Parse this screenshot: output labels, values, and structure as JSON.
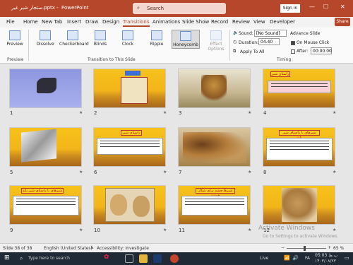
{
  "titlebar": {
    "filename": "ستجار شیر غیر.pptx",
    "separator": "-",
    "app": "PowerPoint",
    "search_placeholder": "Search",
    "signin": "Sign in",
    "minimize": "—",
    "maximize": "☐",
    "close": "✕"
  },
  "tabs": [
    "File",
    "Home",
    "New Tab",
    "Insert",
    "Draw",
    "Design",
    "Transitions",
    "Animations",
    "Slide Show",
    "Record",
    "Review",
    "View",
    "Developer"
  ],
  "active_tab": "Transitions",
  "share_label": "Share",
  "ribbon": {
    "preview": "Preview",
    "preview_group": "Preview",
    "transitions": [
      "Dissolve",
      "Checkerboard",
      "Blinds",
      "Clock",
      "Ripple",
      "Honeycomb"
    ],
    "selected_transition": "Honeycomb",
    "effect_options_1": "Effect",
    "effect_options_2": "Options",
    "transition_group": "Transition to This Slide",
    "sound_label": "Sound:",
    "sound_value": "[No Sound]",
    "duration_label": "Duration:",
    "duration_value": "04.40",
    "apply_all": "Apply To All",
    "advance_label": "Advance Slide",
    "on_click": "On Mouse Click",
    "after_label": "After:",
    "after_value": "00:00.00",
    "timing_group": "Timing"
  },
  "slides": [
    {
      "num": "1",
      "title": ""
    },
    {
      "num": "2",
      "title": ""
    },
    {
      "num": "3",
      "title": ""
    },
    {
      "num": "4",
      "title": "راستای شیر"
    },
    {
      "num": "5",
      "title": ""
    },
    {
      "num": "6",
      "title": "راستای شیر"
    },
    {
      "num": "7",
      "title": ""
    },
    {
      "num": "8",
      "title": "شیرهای با راستای شیر بلند"
    },
    {
      "num": "9",
      "title": "شیرهای با راستای شیر بلند"
    },
    {
      "num": "10",
      "title": ""
    },
    {
      "num": "11",
      "title": "شیرها چشم برای شکار هستند"
    },
    {
      "num": "12",
      "title": ""
    }
  ],
  "status": {
    "slide": "Slide 38 of 38",
    "language": "English (United States)",
    "accessibility": "Accessibility: Investigate",
    "zoom": "65 %"
  },
  "watermark": {
    "line1": "Activate Windows",
    "line2": "Go to Settings to activate Windows."
  },
  "taskbar": {
    "search": "Type here to search",
    "live": "Live",
    "lang": "FA",
    "time": "05:03 ب.ظ",
    "date": "۱۴۰۳/۰۸/۲۳"
  }
}
